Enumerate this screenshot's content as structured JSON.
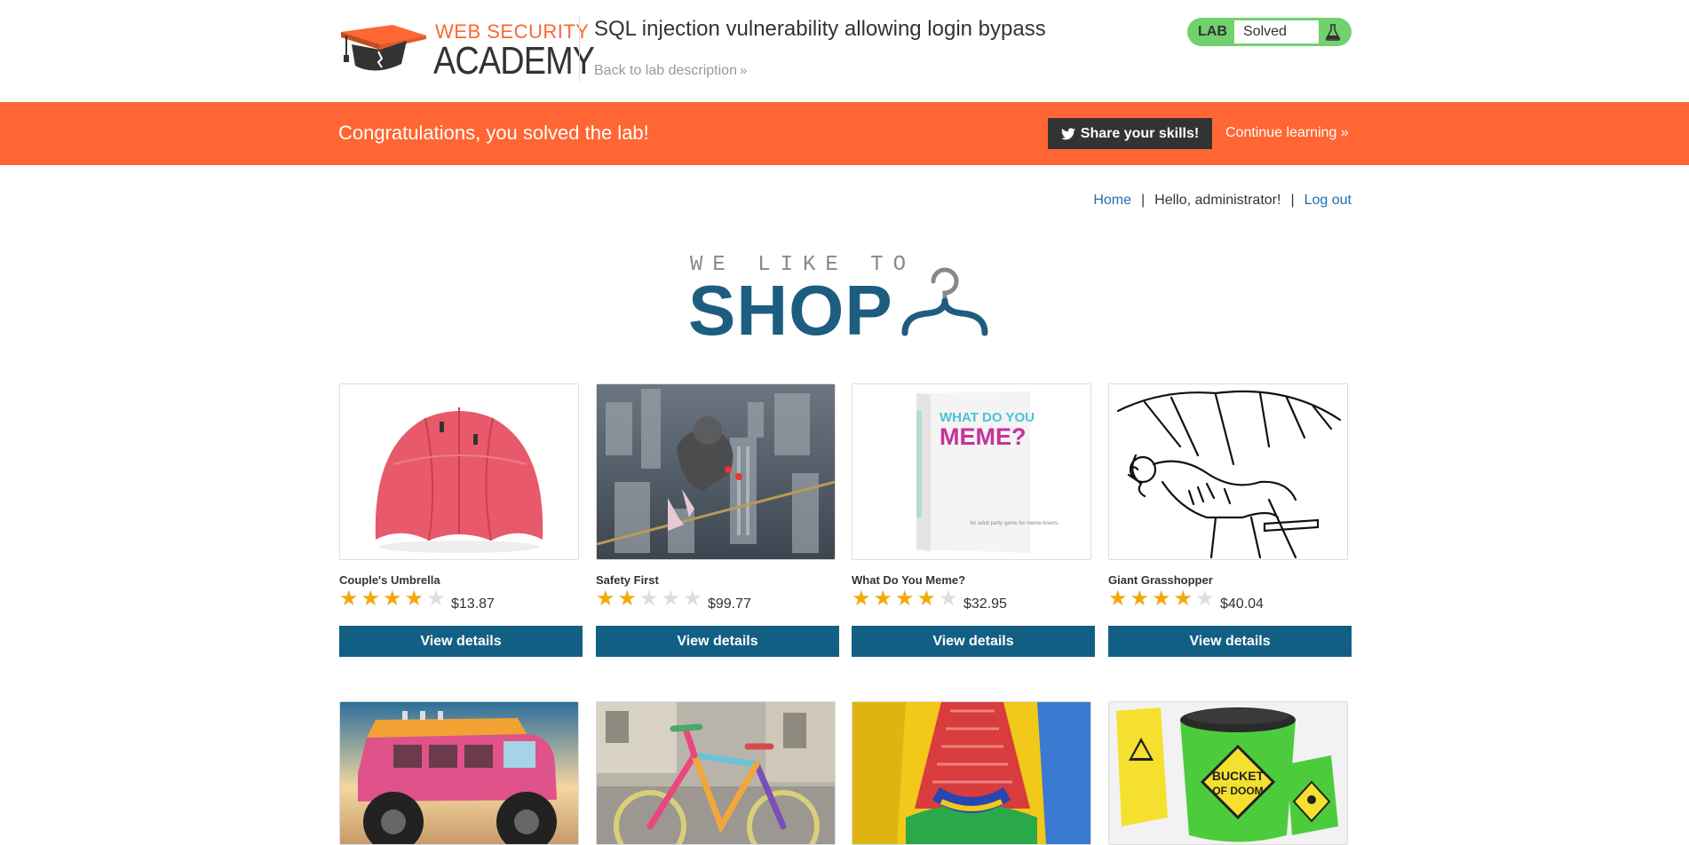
{
  "header": {
    "logo_top": "WEB SECURITY",
    "logo_bottom": "ACADEMY",
    "lab_title": "SQL injection vulnerability allowing login bypass",
    "back_link": "Back to lab description",
    "lab_label": "LAB",
    "lab_status": "Solved"
  },
  "banner": {
    "message": "Congratulations, you solved the lab!",
    "share_label": "Share your skills!",
    "continue_label": "Continue learning"
  },
  "nav": {
    "home": "Home",
    "greeting": "Hello, administrator!",
    "logout": "Log out"
  },
  "hero": {
    "small": "WE LIKE TO",
    "big": "SHOP"
  },
  "colors": {
    "accent": "#ff6633",
    "brand": "#135f84",
    "lab_solved": "#70d16d",
    "star": "#f4a80b"
  },
  "products": [
    {
      "name": "Couple's Umbrella",
      "rating": 4,
      "price": "$13.87",
      "button": "View details"
    },
    {
      "name": "Safety First",
      "rating": 2,
      "price": "$99.77",
      "button": "View details"
    },
    {
      "name": "What Do You Meme?",
      "rating": 4,
      "price": "$32.95",
      "button": "View details"
    },
    {
      "name": "Giant Grasshopper",
      "rating": 4,
      "price": "$40.04",
      "button": "View details"
    }
  ],
  "product_images": {
    "meme_box_line1": "WHAT DO YOU",
    "meme_box_line2": "MEME?",
    "meme_box_small": "An adult party game for meme-lovers.",
    "bucket_line1": "BUCKET",
    "bucket_line2": "OF DOOM"
  }
}
